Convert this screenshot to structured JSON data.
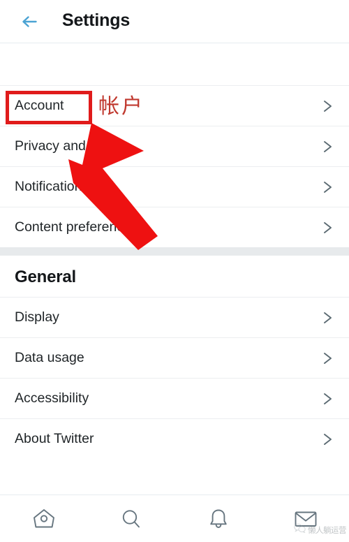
{
  "header": {
    "title": "Settings",
    "back_icon": "arrow-left-icon",
    "back_color": "#4BA3D3"
  },
  "sections": [
    {
      "id": "main",
      "title": null,
      "items": [
        {
          "label": "Account",
          "chevron": "chevron-right-icon"
        },
        {
          "label": "Privacy and s",
          "chevron": "chevron-right-icon"
        },
        {
          "label": "Notifications",
          "chevron": "chevron-right-icon"
        },
        {
          "label": "Content preferences",
          "chevron": "chevron-right-icon"
        }
      ]
    },
    {
      "id": "general",
      "title": "General",
      "items": [
        {
          "label": "Display",
          "chevron": "chevron-right-icon"
        },
        {
          "label": "Data usage",
          "chevron": "chevron-right-icon"
        },
        {
          "label": "Accessibility",
          "chevron": "chevron-right-icon"
        },
        {
          "label": "About Twitter",
          "chevron": "chevron-right-icon"
        }
      ]
    }
  ],
  "bottom_nav": {
    "items": [
      {
        "icon": "home-icon",
        "label": "Home"
      },
      {
        "icon": "search-icon",
        "label": "Search"
      },
      {
        "icon": "bell-icon",
        "label": "Notifications"
      },
      {
        "icon": "mail-icon",
        "label": "Messages"
      }
    ],
    "icon_color": "#66757f"
  },
  "annotations": {
    "highlight_target": "Account",
    "highlight_color": "#e01b1b",
    "chinese_label": "帐户",
    "chinese_color": "#c0392f",
    "arrow_color": "#ee1111",
    "arrow_points_to": "Account"
  },
  "watermark": {
    "text": "懒人躺运营",
    "logo": "wechat-icon"
  },
  "colors": {
    "background": "#ffffff",
    "separator": "#eceef0",
    "band": "#e7eaec",
    "text_primary": "#1f2427",
    "text_heading": "#14171a",
    "accent_blue": "#4BA3D3"
  }
}
